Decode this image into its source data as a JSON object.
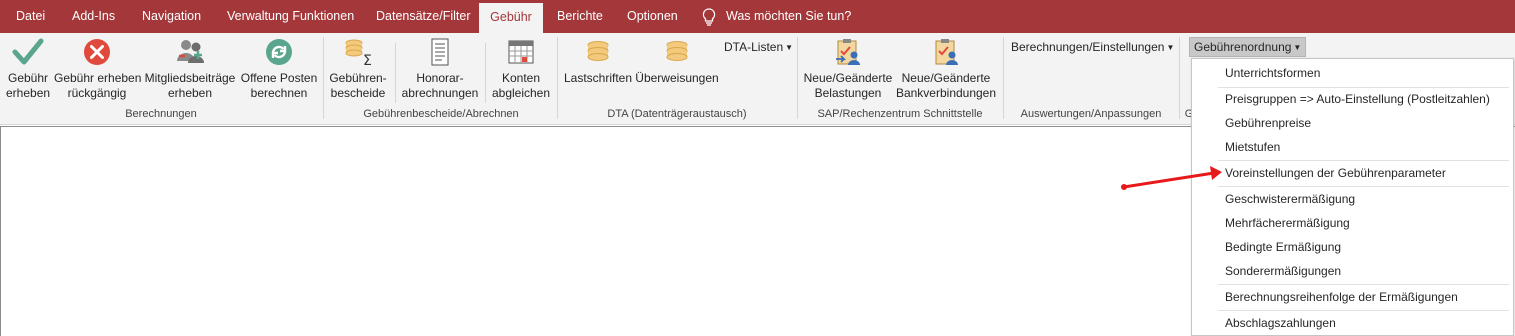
{
  "tabs": [
    "Datei",
    "Add-Ins",
    "Navigation",
    "Verwaltung Funktionen",
    "Datensätze/Filter",
    "Gebühr",
    "Berichte",
    "Optionen"
  ],
  "tell_me": "Was möchten Sie tun?",
  "ribbon": {
    "berechnungen": {
      "label": "Berechnungen",
      "buttons": [
        {
          "l1": "Gebühr",
          "l2": "erheben"
        },
        {
          "l1": "Gebühr erheben",
          "l2": "rückgängig"
        },
        {
          "l1": "Mitgliedsbeiträge",
          "l2": "erheben"
        },
        {
          "l1": "Offene Posten",
          "l2": "berechnen"
        }
      ]
    },
    "bescheide": {
      "label": "Gebührenbescheide/Abrechnen",
      "buttons": [
        {
          "l1": "Gebühren-",
          "l2": "bescheide"
        },
        {
          "l1": "Honorar-",
          "l2": "abrechnungen"
        },
        {
          "l1": "Konten",
          "l2": "abgleichen"
        }
      ]
    },
    "dta": {
      "label": "DTA (Datenträgeraustausch)",
      "buttons": [
        {
          "l1": "Lastschriften"
        },
        {
          "l1": "Überweisungen"
        }
      ],
      "dropdown": "DTA-Listen"
    },
    "sap": {
      "label": "SAP/Rechenzentrum Schnittstelle",
      "buttons": [
        {
          "l1": "Neue/Geänderte",
          "l2": "Belastungen"
        },
        {
          "l1": "Neue/Geänderte",
          "l2": "Bankverbindungen"
        }
      ]
    },
    "auswertungen": {
      "label": "Auswertungen/Anpassungen",
      "dropdown": "Berechnungen/Einstellungen"
    },
    "gebuehrenordnung": {
      "label_fragment": "G",
      "dropdown": "Gebührenordnung"
    }
  },
  "menu": {
    "items": [
      "Unterrichtsformen",
      "Preisgruppen => Auto-Einstellung (Postleitzahlen)",
      "Gebührenpreise",
      "Mietstufen",
      "Voreinstellungen der Gebührenparameter",
      "Geschwisterermäßigung",
      "Mehrfächerermäßigung",
      "Bedingte Ermäßigung",
      "Sonderermäßigungen",
      "Berechnungsreihenfolge der Ermäßigungen",
      "Abschlagszahlungen"
    ]
  },
  "colors": {
    "title_bar": "#a4373a",
    "ribbon_bg": "#f3f3f3",
    "accent_green": "#5aa58e",
    "accent_red": "#e04a3c",
    "arrow": "#e8191b"
  }
}
